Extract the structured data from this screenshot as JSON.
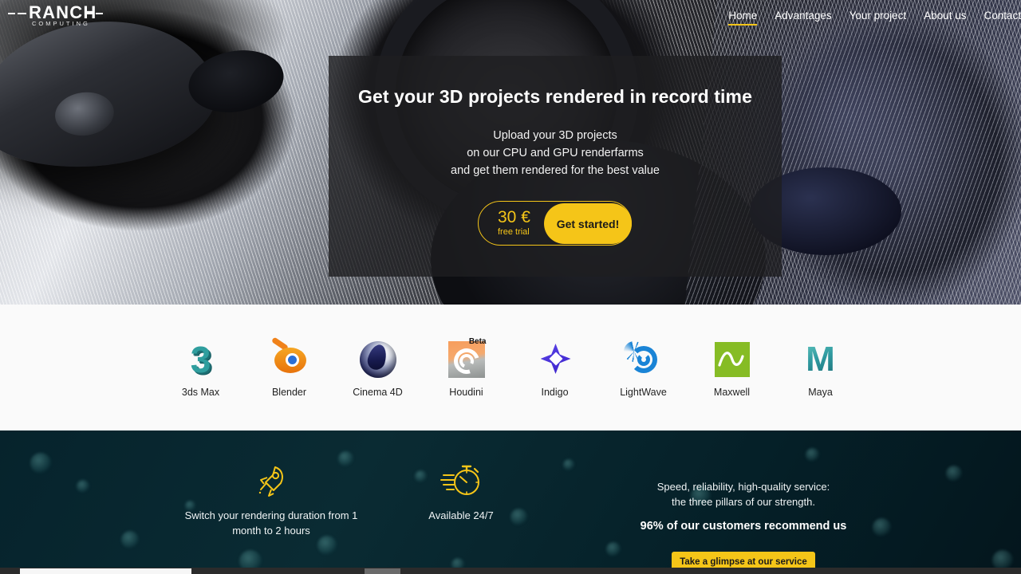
{
  "brand": {
    "logo_word": "RANCH",
    "logo_sub": "COMPUTING",
    "accent_color": "#f5c518"
  },
  "nav": {
    "items": [
      {
        "label": "Home",
        "active": true
      },
      {
        "label": "Advantages",
        "active": false
      },
      {
        "label": "Your project",
        "active": false
      },
      {
        "label": "About us",
        "active": false
      },
      {
        "label": "Contact",
        "active": false
      }
    ]
  },
  "hero": {
    "title": "Get your 3D projects rendered in record time",
    "sub_line1": "Upload your 3D projects",
    "sub_line2": "on our CPU and GPU renderfarms",
    "sub_line3": "and get them rendered for the best value",
    "price_amount": "30 €",
    "price_note": "free trial",
    "cta_label": "Get started!"
  },
  "software": {
    "items": [
      {
        "label": "3ds Max",
        "icon": "3ds-max-icon"
      },
      {
        "label": "Blender",
        "icon": "blender-icon"
      },
      {
        "label": "Cinema 4D",
        "icon": "cinema-4d-icon"
      },
      {
        "label": "Houdini",
        "icon": "houdini-icon",
        "badge": "Beta"
      },
      {
        "label": "Indigo",
        "icon": "indigo-icon"
      },
      {
        "label": "LightWave",
        "icon": "lightwave-icon"
      },
      {
        "label": "Maxwell",
        "icon": "maxwell-icon"
      },
      {
        "label": "Maya",
        "icon": "maya-icon"
      }
    ]
  },
  "features": {
    "col1": {
      "icon": "rocket-icon",
      "line1": "Switch your rendering duration from 1",
      "line2": "month to 2 hours"
    },
    "col2": {
      "icon": "stopwatch-icon",
      "line1": "Available 24/7"
    },
    "col3": {
      "line1": "Speed, reliability, high-quality service:",
      "line2": "the three pillars of our strength.",
      "strong": "96% of our customers recommend us",
      "button_label": "Take a glimpse at our service"
    }
  }
}
